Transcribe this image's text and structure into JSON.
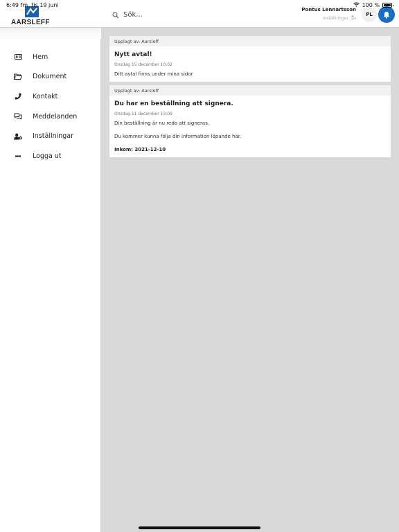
{
  "statusbar": {
    "time": "6:49 fm",
    "date": "tis 19 juni",
    "battery": "100 %"
  },
  "header": {
    "logo_text": "AARSLEFF",
    "search_placeholder": "Sök...",
    "user_name": "Pontus Lennartsson",
    "user_settings": "Inställningar",
    "avatar_initials": "PL",
    "accent_color": "#1a6ec0"
  },
  "sidebar": {
    "items": [
      {
        "label": "Hem",
        "icon": "id-card-icon"
      },
      {
        "label": "Dokument",
        "icon": "folder-open-icon"
      },
      {
        "label": "Kontakt",
        "icon": "phone-icon"
      },
      {
        "label": "Meddelanden",
        "icon": "chat-bubbles-icon"
      },
      {
        "label": "Inställningar",
        "icon": "user-gear-icon"
      },
      {
        "label": "Logga ut",
        "icon": "minus-icon"
      }
    ]
  },
  "feed": [
    {
      "meta": "Upplagt av: Aarsleff",
      "title": "Nytt avtal!",
      "date": "Onsdag 15 december 10:02",
      "lines": [
        "Ditt avtal finns under mina sidor"
      ]
    },
    {
      "meta": "Upplagt av: Aarsleff",
      "title": "Du har en beställning att signera.",
      "date": "Onsdag 11 december 13:09",
      "lines": [
        "Din beställning är nu redo att signeras.",
        "Du kommer kunna följa din information löpande här."
      ],
      "strong": "Inkom: 2021-12-10"
    }
  ]
}
